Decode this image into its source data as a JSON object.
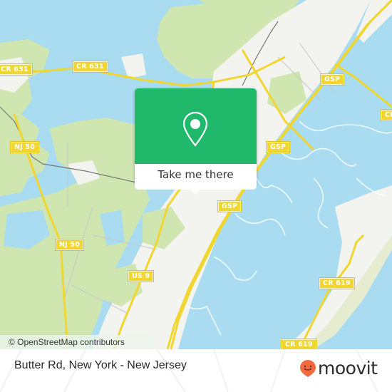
{
  "map": {
    "colors": {
      "water": "#a9dcf0",
      "land": "#f3f3ef",
      "vegetation": "#cfe6b0",
      "road": "#f1d631",
      "road_casing": "#e6c81e",
      "rail": "#777777",
      "minor_road": "#c8c6cc"
    },
    "road_shields": [
      {
        "label": "CR 631",
        "id": "cr-631-west"
      },
      {
        "label": "CR 631",
        "id": "cr-631-center"
      },
      {
        "label": "GSP",
        "id": "gsp-north"
      },
      {
        "label": "CR",
        "id": "cr-east-edge"
      },
      {
        "label": "NJ 50",
        "id": "nj-50-north"
      },
      {
        "label": "GSP",
        "id": "gsp-middle"
      },
      {
        "label": "GSP",
        "id": "gsp-south"
      },
      {
        "label": "NJ 50",
        "id": "nj-50-south"
      },
      {
        "label": "US 9",
        "id": "us-9"
      },
      {
        "label": "CR 619",
        "id": "cr-619-north"
      },
      {
        "label": "CR 619",
        "id": "cr-619-south"
      }
    ],
    "attribution": "© OpenStreetMap contributors"
  },
  "popup": {
    "icon": "location-pin-icon",
    "action_label": "Take me there",
    "accent_color": "#20b96b"
  },
  "footer": {
    "title": "Butter Rd, New York - New Jersey",
    "logo_text": "moovit",
    "logo_color": "#f26a3d"
  }
}
